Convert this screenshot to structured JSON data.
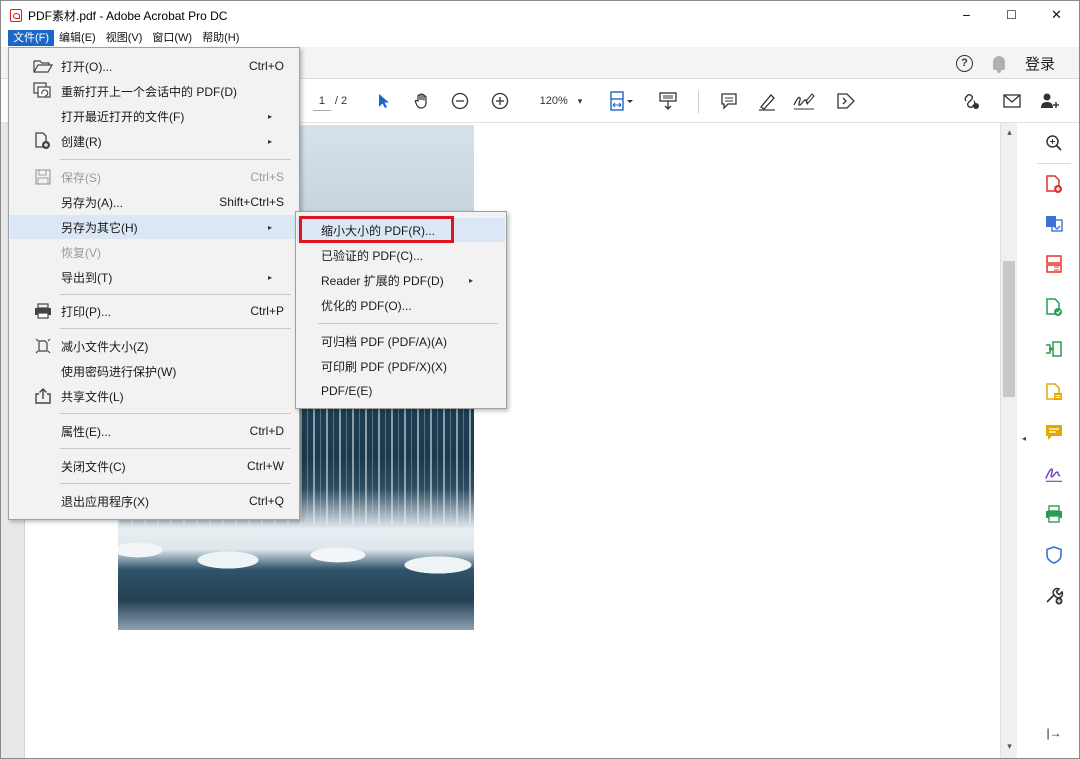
{
  "window": {
    "title": "PDF素材.pdf - Adobe Acrobat Pro DC",
    "controls": {
      "minimize": "−",
      "maximize": "☐",
      "close": "✕"
    }
  },
  "menubar": {
    "items": [
      "文件(F)",
      "编辑(E)",
      "视图(V)",
      "窗口(W)",
      "帮助(H)"
    ]
  },
  "topnav": {
    "help": "?",
    "login": "登录"
  },
  "toolbar": {
    "page_current": "1",
    "page_total": "/ 2",
    "zoom": "120%",
    "zoom_arrow": "▾"
  },
  "file_menu": {
    "items": [
      {
        "label": "打开(O)...",
        "shortcut": "Ctrl+O"
      },
      {
        "label": "重新打开上一个会话中的 PDF(D)",
        "shortcut": ""
      },
      {
        "label": "打开最近打开的文件(F)",
        "shortcut": ""
      },
      {
        "label": "创建(R)",
        "shortcut": ""
      },
      {
        "label": "保存(S)",
        "shortcut": "Ctrl+S"
      },
      {
        "label": "另存为(A)...",
        "shortcut": "Shift+Ctrl+S"
      },
      {
        "label": "另存为其它(H)",
        "shortcut": ""
      },
      {
        "label": "恢复(V)",
        "shortcut": ""
      },
      {
        "label": "导出到(T)",
        "shortcut": ""
      },
      {
        "label": "打印(P)...",
        "shortcut": "Ctrl+P"
      },
      {
        "label": "减小文件大小(Z)",
        "shortcut": ""
      },
      {
        "label": "使用密码进行保护(W)",
        "shortcut": ""
      },
      {
        "label": "共享文件(L)",
        "shortcut": ""
      },
      {
        "label": "属性(E)...",
        "shortcut": "Ctrl+D"
      },
      {
        "label": "关闭文件(C)",
        "shortcut": "Ctrl+W"
      },
      {
        "label": "退出应用程序(X)",
        "shortcut": "Ctrl+Q"
      }
    ],
    "submenu_arrow": "▸"
  },
  "save_as_other_submenu": {
    "items": [
      {
        "label": "缩小大小的 PDF(R)..."
      },
      {
        "label": "已验证的 PDF(C)..."
      },
      {
        "label": "Reader 扩展的 PDF(D)"
      },
      {
        "label": "优化的 PDF(O)..."
      },
      {
        "label": "可归档 PDF (PDF/A)(A)"
      },
      {
        "label": "可印刷 PDF (PDF/X)(X)"
      },
      {
        "label": "PDF/E(E)"
      }
    ]
  },
  "scrollbar": {
    "up": "▴",
    "down": "▾"
  },
  "right_panel": {
    "collapse": "◂",
    "collapse_panel": "|→"
  },
  "colors": {
    "accent": "#1b66c9",
    "highlight_box": "#e0141e",
    "menu_bg": "#f2f2f2",
    "menu_hover": "#dce7f5"
  }
}
